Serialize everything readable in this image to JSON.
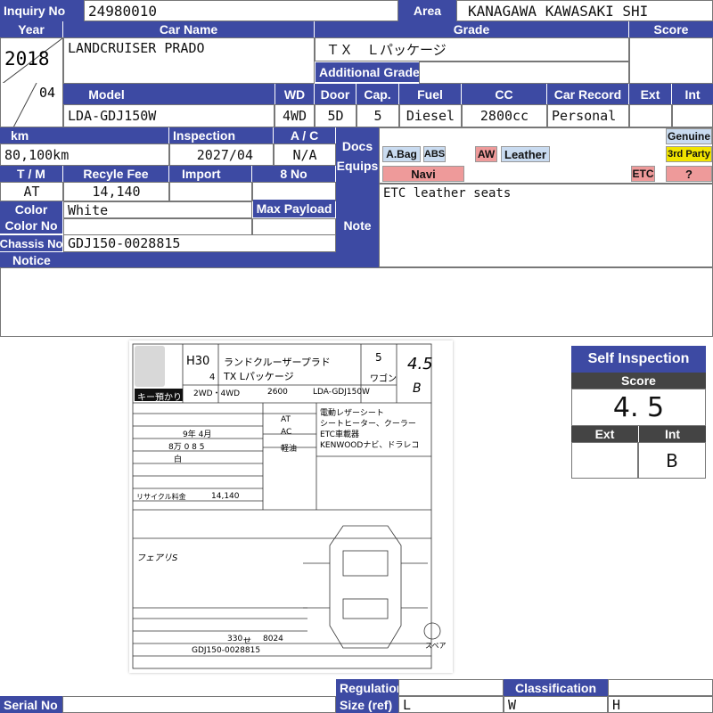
{
  "header": {
    "inquiry_label": "Inquiry No",
    "inquiry_no": "24980010",
    "area_label": "Area",
    "area": "KANAGAWA KAWASAKI SHI"
  },
  "row1": {
    "year_label": "Year",
    "car_name_label": "Car Name",
    "grade_label": "Grade",
    "score_label": "Score",
    "year": "2018",
    "month": "04",
    "car_name": "LANDCRUISER PRADO",
    "grade": "ＴＸ　Ｌパッケージ",
    "additional_grade_label": "Additional Grade",
    "additional_grade": "",
    "score": ""
  },
  "row2": {
    "model_label": "Model",
    "wd_label": "WD",
    "door_label": "Door",
    "cap_label": "Cap.",
    "fuel_label": "Fuel",
    "cc_label": "CC",
    "car_record_label": "Car Record",
    "ext_label": "Ext",
    "int_label": "Int",
    "model": "LDA-GDJ150W",
    "wd": "4WD",
    "door": "5D",
    "cap": "5",
    "fuel": "Diesel",
    "cc": "2800cc",
    "car_record": "Personal",
    "ext": "",
    "int": ""
  },
  "details": {
    "km_label": "km",
    "inspection_label": "Inspection",
    "ac_label": "A / C",
    "km": "80,100km",
    "inspection": "2027/04",
    "ac": "N/A",
    "tm_label": "T / M",
    "recycle_label": "Recyle Fee",
    "import_label": "Import",
    "eight_no_label": "8 No",
    "tm": "AT",
    "recycle_fee": "14,140",
    "import": "",
    "eight_no": "",
    "color_label": "Color",
    "color": "White",
    "max_payload_label": "Max Payload",
    "max_payload": "",
    "color_no_label": "Color No",
    "color_no": "",
    "chassis_label": "Chassis No",
    "chassis_no": "GDJ150-0028815",
    "notice_label": "Notice",
    "notice": ""
  },
  "docs": {
    "docs_label": "Docs",
    "equips_label": "Equips",
    "note_label": "Note",
    "note": "ETC leather seats",
    "badges": {
      "abag": "A.Bag",
      "abs": "ABS",
      "aw": "AW",
      "leather": "Leather",
      "navi": "Navi",
      "etc": "ETC",
      "genuine": "Genuine",
      "third_party": "3rd Party",
      "question": "?"
    }
  },
  "colors": {
    "header_blue": "#3d4aa3",
    "badge_blue": "#c9dbf0",
    "badge_red": "#ee9a9a",
    "badge_yellow": "#f1e300"
  },
  "sheet": {
    "year_era": "H30",
    "month": "4",
    "name": "ランドクルーザープラド",
    "grade": "TX Lパッケージ",
    "doors": "5",
    "body": "ワゴン",
    "score": "4.5",
    "int_grade": "B",
    "key": "キー預かり",
    "drive": "2WD・4WD",
    "cc": "2600",
    "model": "LDA-GDJ150W",
    "shift": "AT",
    "ac": "AC",
    "fuel": "軽油",
    "sale_points": [
      "電動レザーシート",
      "シートヒーター、クーラー",
      "ETC車載器",
      "KENWOODナビ、ドラレコ"
    ],
    "inspection": "9年 4月",
    "mileage": "8万 0 8 5",
    "color": "白",
    "recycle_label": "リサイクル料金",
    "recycle": "14,140",
    "chassis": "GDJ150-0028815",
    "reg_no": "330",
    "reg_kana": "せ",
    "reg_num": "8024",
    "spare": "スペア",
    "handwritten": "フェアリS"
  },
  "self_inspection": {
    "title": "Self Inspection",
    "score_label": "Score",
    "score": "4. 5",
    "ext_label": "Ext",
    "int_label": "Int",
    "ext": "",
    "int": "B"
  },
  "footer": {
    "serial_label": "Serial No",
    "serial_no": "",
    "regulation_label": "Regulation",
    "size_label": "Size (ref)",
    "size_l": "L",
    "classification_label": "Classification",
    "size_w": "W",
    "size_h": "H"
  }
}
